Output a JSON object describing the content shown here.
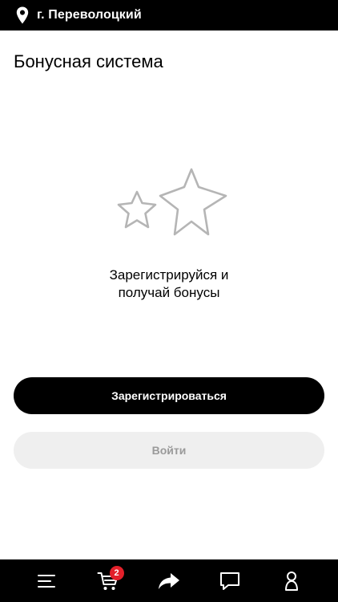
{
  "header": {
    "city": "г. Переволоцкий",
    "icon": "location-pin-icon"
  },
  "page": {
    "title": "Бонусная система"
  },
  "promo": {
    "icon": "stars-icon",
    "line1": "Зарегистрируйся и",
    "line2": "получай бонусы"
  },
  "buttons": {
    "register": "Зарегистрироваться",
    "login": "Войти"
  },
  "tabbar": {
    "items": [
      {
        "name": "menu",
        "icon": "menu-icon"
      },
      {
        "name": "cart",
        "icon": "cart-icon",
        "badge": "2"
      },
      {
        "name": "share",
        "icon": "share-arrow-icon"
      },
      {
        "name": "chat",
        "icon": "chat-bubble-icon"
      },
      {
        "name": "profile",
        "icon": "user-icon"
      }
    ]
  },
  "colors": {
    "bar_background": "#000000",
    "primary_button": "#000000",
    "secondary_button": "#efefef",
    "badge": "#e3202a",
    "star_outline": "#b5b5b5"
  }
}
